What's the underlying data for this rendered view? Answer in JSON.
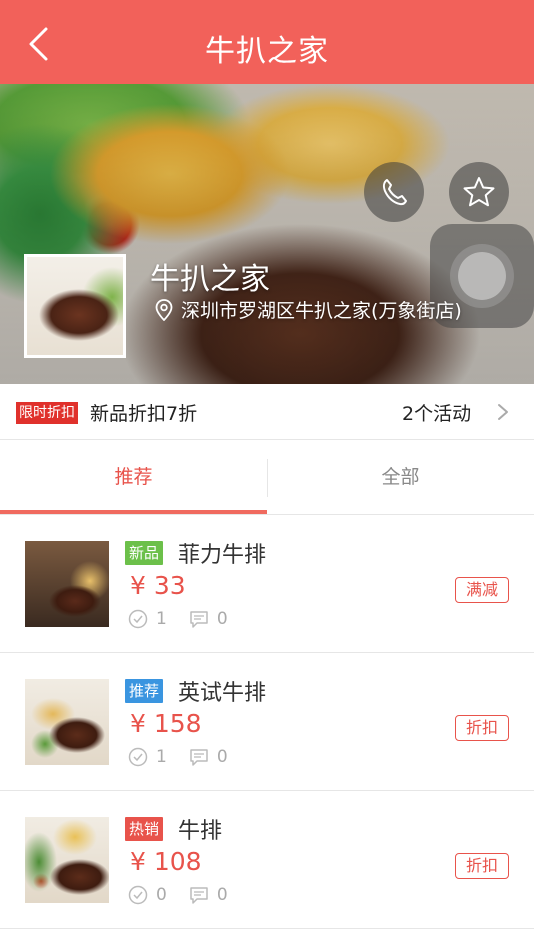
{
  "header": {
    "title": "牛扒之家",
    "background_color": "#f2615a"
  },
  "store": {
    "name": "牛扒之家",
    "address": "深圳市罗湖区牛扒之家(万象街店)"
  },
  "promo": {
    "tag": "限时折扣",
    "text": "新品折扣7折",
    "count": "2个活动"
  },
  "tabs": [
    {
      "label": "推荐",
      "active": true
    },
    {
      "label": "全部",
      "active": false
    }
  ],
  "items": [
    {
      "badge": "新品",
      "badge_color": "#6cc04a",
      "name": "菲力牛排",
      "price": "¥ 33",
      "sales": "1",
      "comments": "0",
      "promo_label": "满减"
    },
    {
      "badge": "推荐",
      "badge_color": "#3a95e0",
      "name": "英试牛排",
      "price": "¥ 158",
      "sales": "1",
      "comments": "0",
      "promo_label": "折扣"
    },
    {
      "badge": "热销",
      "badge_color": "#e8534b",
      "name": "牛排",
      "price": "¥ 108",
      "sales": "0",
      "comments": "0",
      "promo_label": "折扣"
    }
  ],
  "icons": {
    "back": "chevron-left-icon",
    "call": "phone-icon",
    "favorite": "star-icon",
    "location": "location-pin-icon",
    "arrow": "chevron-right-icon",
    "sales": "check-circle-icon",
    "comments": "comment-icon"
  }
}
